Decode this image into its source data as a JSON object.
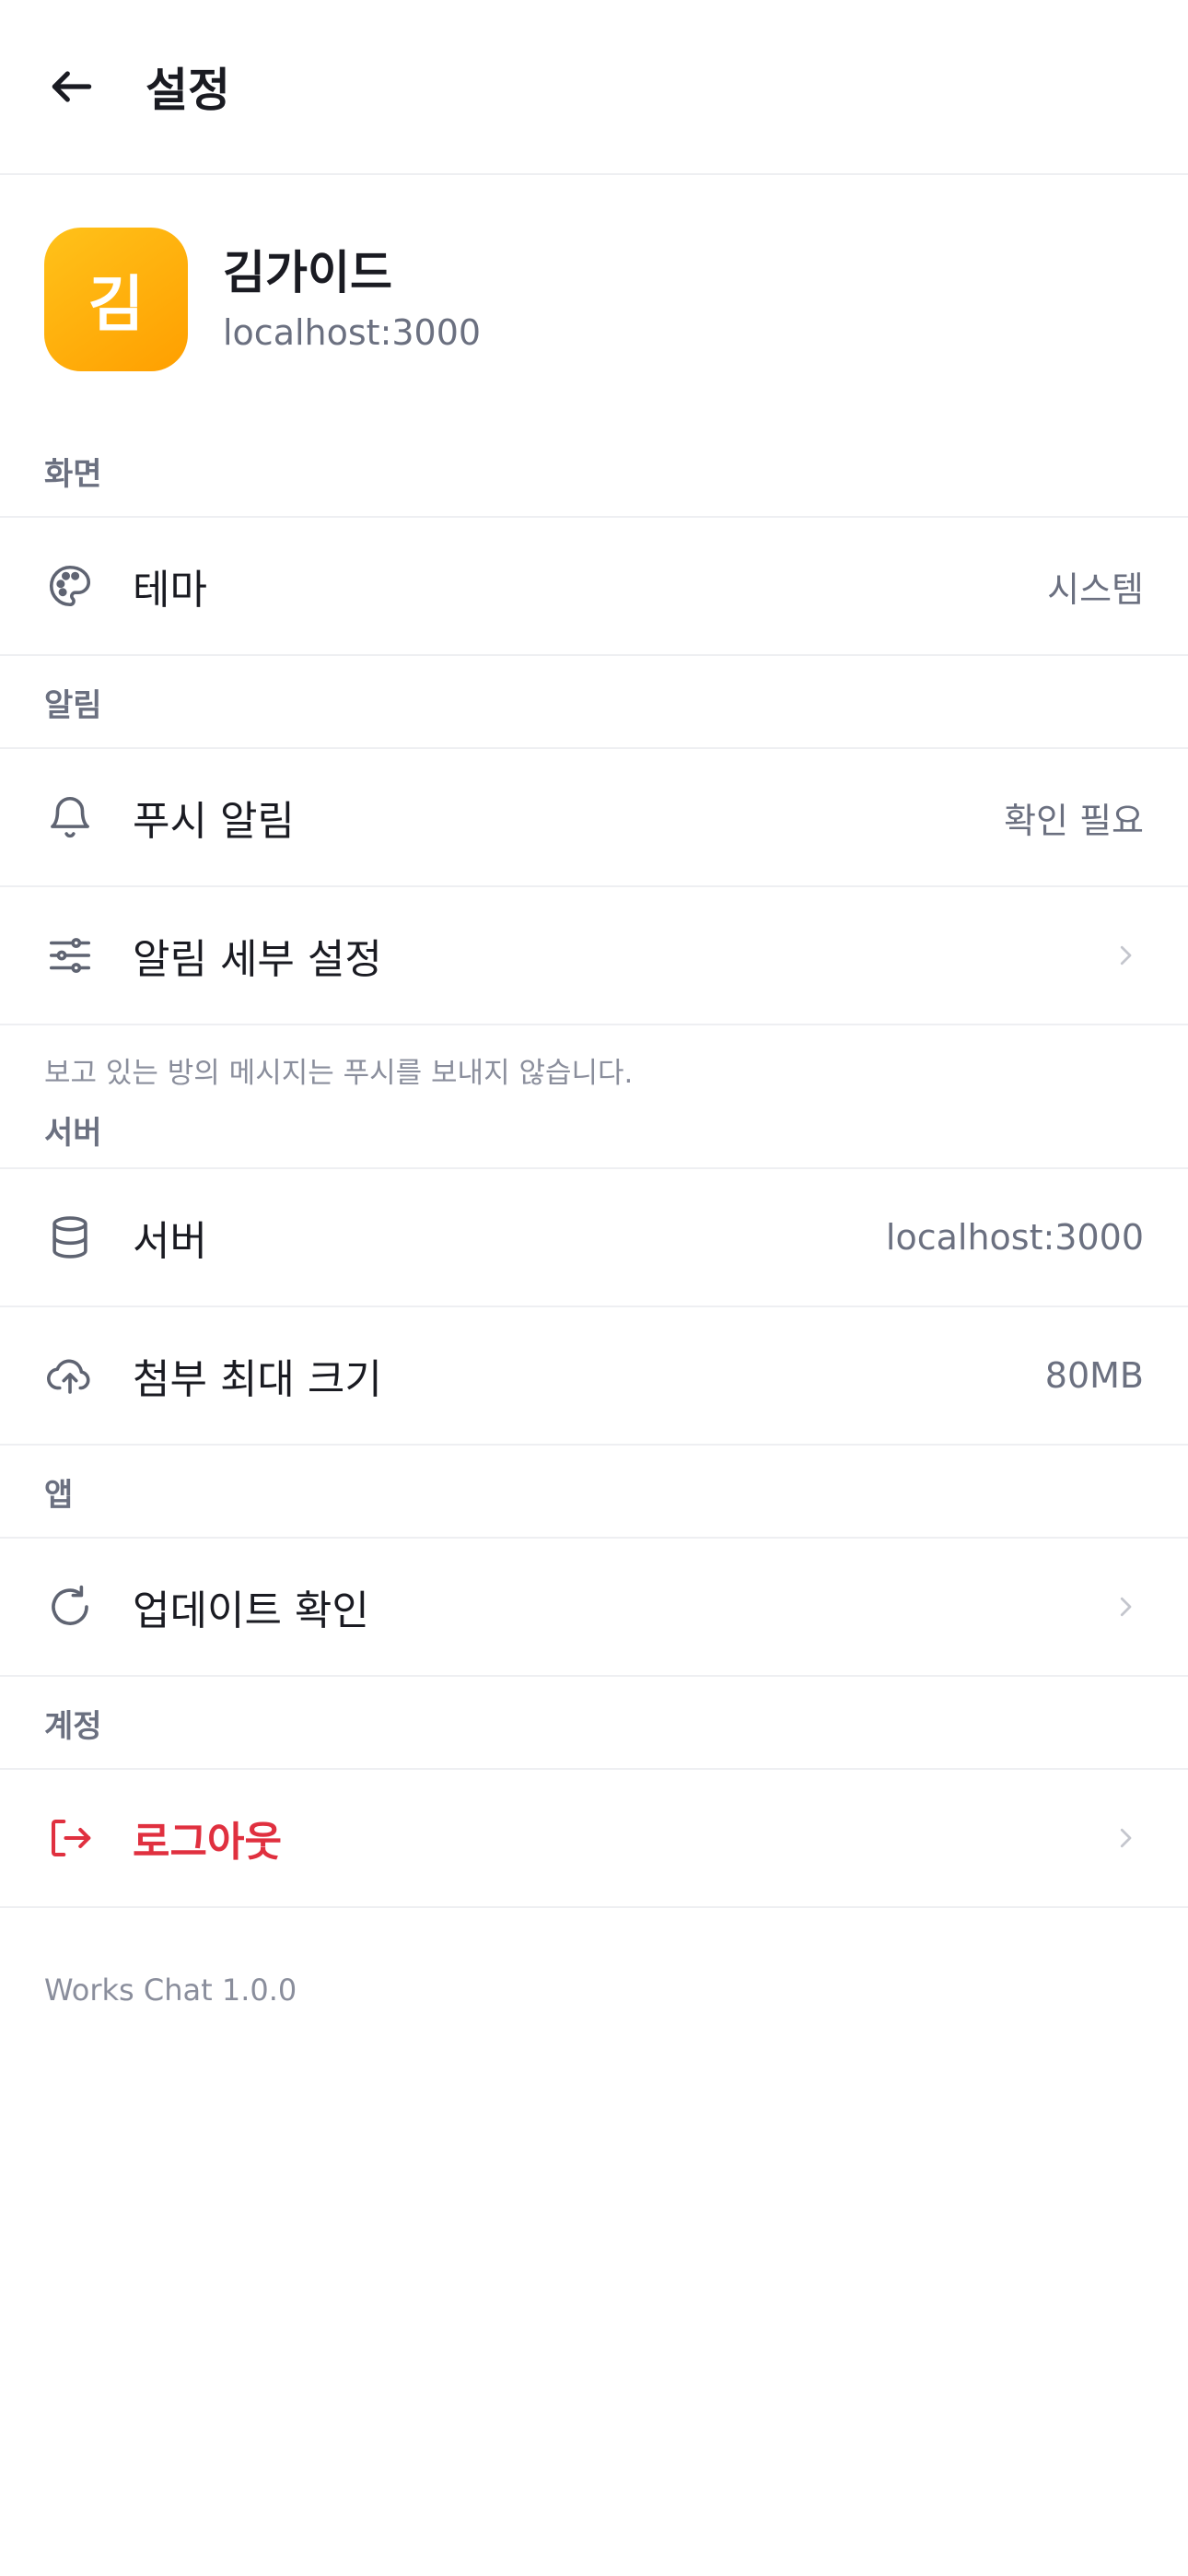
{
  "header": {
    "title": "설정"
  },
  "profile": {
    "avatar_initial": "김",
    "name": "김가이드",
    "host": "localhost:3000"
  },
  "sections": {
    "display": {
      "label": "화면",
      "theme": {
        "label": "테마",
        "value": "시스템",
        "icon": "palette-icon"
      }
    },
    "notifications": {
      "label": "알림",
      "push": {
        "label": "푸시 알림",
        "value": "확인 필요",
        "icon": "bell-icon"
      },
      "detail": {
        "label": "알림 세부 설정",
        "icon": "sliders-icon"
      },
      "note": "보고 있는 방의 메시지는 푸시를 보내지 않습니다."
    },
    "server": {
      "label": "서버",
      "server": {
        "label": "서버",
        "value": "localhost:3000",
        "icon": "database-icon"
      },
      "upload": {
        "label": "첨부 최대 크기",
        "value": "80MB",
        "icon": "cloud-upload-icon"
      }
    },
    "app": {
      "label": "앱",
      "update": {
        "label": "업데이트 확인",
        "icon": "refresh-icon"
      }
    },
    "account": {
      "label": "계정",
      "logout": {
        "label": "로그아웃",
        "icon": "logout-icon"
      }
    }
  },
  "footer": {
    "version": "Works Chat 1.0.0"
  },
  "colors": {
    "accent_danger": "#e0303f",
    "avatar_start": "#ffc21a",
    "avatar_end": "#ff9f00"
  }
}
